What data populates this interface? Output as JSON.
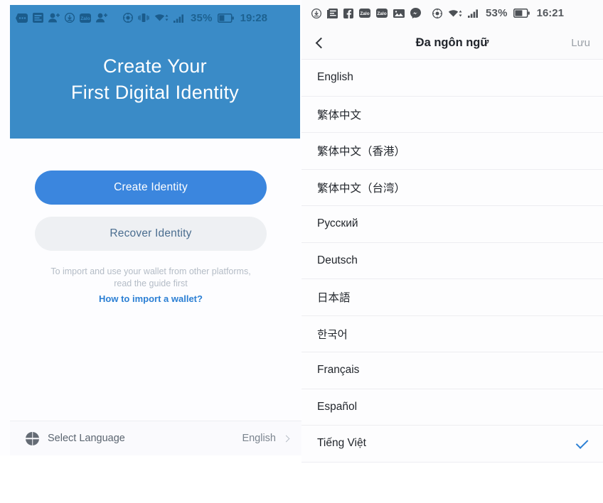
{
  "left": {
    "statusbar": {
      "icons": [
        "message-icon",
        "news-icon",
        "person-add-icon",
        "download-icon",
        "zalo-icon",
        "person-add-icon-2",
        "location-icon",
        "vibrate-icon",
        "wifi-icon",
        "signal-icon"
      ],
      "battery_percent": "35%",
      "time": "19:28"
    },
    "hero": {
      "line1": "Create Your",
      "line2": "First Digital Identity"
    },
    "buttons": {
      "create": "Create Identity",
      "recover": "Recover Identity"
    },
    "hint": {
      "line1": "To import and use your wallet from other platforms,",
      "line2": "read the guide first",
      "link": "How to import a wallet?"
    },
    "language_bar": {
      "icon": "globe-icon",
      "label": "Select Language",
      "value": "English",
      "chevron": "chevron-right-icon"
    }
  },
  "right": {
    "statusbar": {
      "icons": [
        "download-icon",
        "news-icon",
        "facebook-icon",
        "zalo-icon",
        "zalo-icon-2",
        "image-icon",
        "messenger-icon",
        "location-icon",
        "wifi-icon",
        "signal-icon"
      ],
      "battery_percent": "53%",
      "time": "16:21"
    },
    "header": {
      "back": "chevron-left-icon",
      "title": "Đa ngôn ngữ",
      "save": "Lưu"
    },
    "languages": [
      {
        "label": "English",
        "selected": false
      },
      {
        "label": "繁体中文",
        "selected": false
      },
      {
        "label": "繁体中文（香港）",
        "selected": false
      },
      {
        "label": "繁体中文（台湾）",
        "selected": false
      },
      {
        "label": "Русский",
        "selected": false
      },
      {
        "label": "Deutsch",
        "selected": false
      },
      {
        "label": "日本語",
        "selected": false
      },
      {
        "label": "한국어",
        "selected": false
      },
      {
        "label": "Français",
        "selected": false
      },
      {
        "label": "Español",
        "selected": false
      },
      {
        "label": "Tiếng Việt",
        "selected": true
      }
    ]
  },
  "colors": {
    "hero_blue": "#3a8bc7",
    "primary_blue": "#3b86de",
    "link_blue": "#2b7fd4",
    "secondary_bg": "#eef0f3"
  }
}
